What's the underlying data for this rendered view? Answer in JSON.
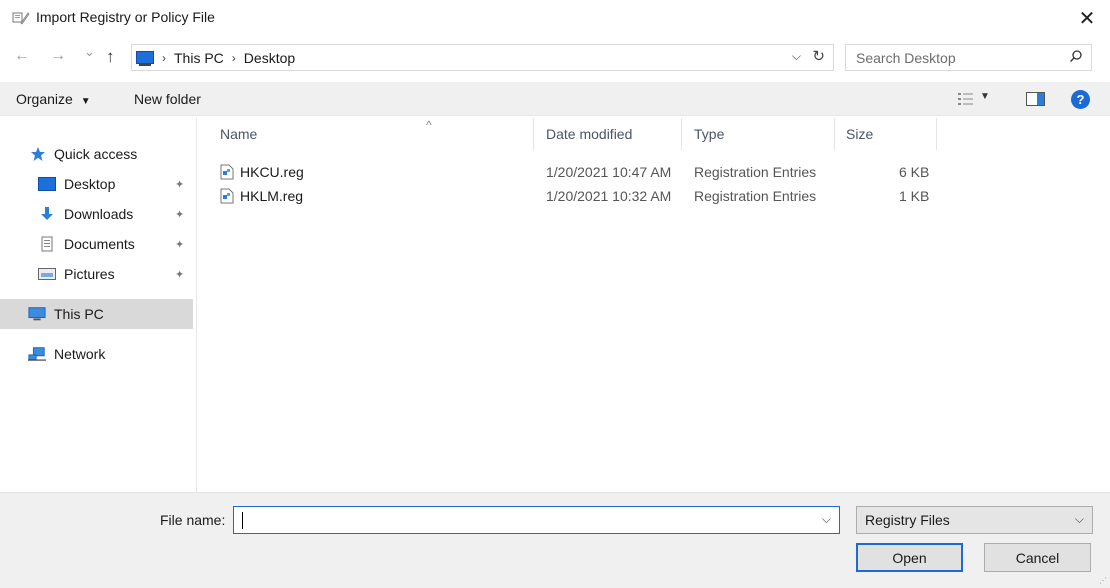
{
  "window": {
    "title": "Import Registry or Policy File",
    "close_glyph": "✕"
  },
  "nav": {
    "back_glyph": "←",
    "forward_glyph": "→",
    "recent_glyph": "⌄",
    "up_glyph": "↑",
    "breadcrumb": [
      "This PC",
      "Desktop"
    ],
    "breadcrumb_sep": "›",
    "dropdown_glyph": "⌵",
    "refresh_glyph": "↻",
    "search_placeholder": "Search Desktop"
  },
  "toolbar": {
    "organize_label": "Organize",
    "organize_caret": "▼",
    "new_folder_label": "New folder",
    "view_caret": "▼",
    "help_glyph": "?"
  },
  "sidebar": {
    "items": [
      {
        "label": "Quick access",
        "icon": "star-icon"
      },
      {
        "label": "Desktop",
        "icon": "desktop-icon",
        "pin": "✦"
      },
      {
        "label": "Downloads",
        "icon": "downloads-icon",
        "pin": "✦"
      },
      {
        "label": "Documents",
        "icon": "documents-icon",
        "pin": "✦"
      },
      {
        "label": "Pictures",
        "icon": "pictures-icon",
        "pin": "✦"
      },
      {
        "label": "This PC",
        "icon": "pc-icon",
        "selected": true
      },
      {
        "label": "Network",
        "icon": "network-icon"
      }
    ]
  },
  "list": {
    "sort_glyph": "^",
    "columns": {
      "name": "Name",
      "date": "Date modified",
      "type": "Type",
      "size": "Size"
    },
    "rows": [
      {
        "name": "HKCU.reg",
        "date": "1/20/2021 10:47 AM",
        "type": "Registration Entries",
        "size": "6 KB"
      },
      {
        "name": "HKLM.reg",
        "date": "1/20/2021 10:32 AM",
        "type": "Registration Entries",
        "size": "1 KB"
      }
    ]
  },
  "footer": {
    "file_name_label": "File name:",
    "file_name_value": "",
    "dropdown_glyph": "⌵",
    "file_type_value": "Registry Files",
    "open_label": "Open",
    "cancel_label": "Cancel",
    "grip_glyph": "⋰"
  },
  "colors": {
    "accent": "#1d6ad6",
    "toolbar_bg": "#f0f0f0",
    "selected_bg": "#d9d9d9"
  }
}
